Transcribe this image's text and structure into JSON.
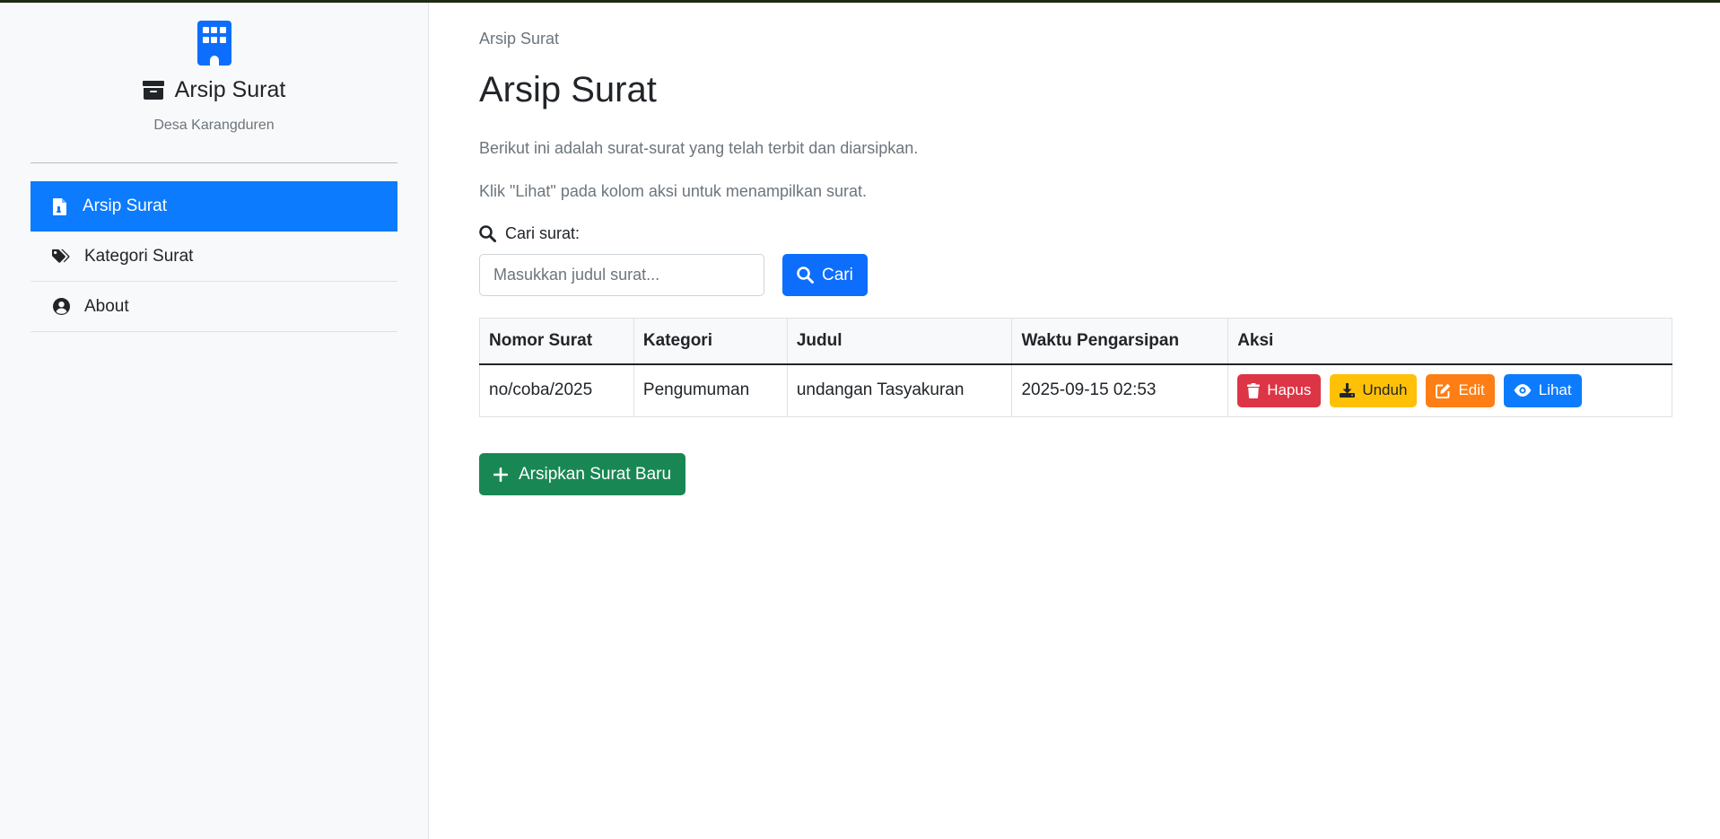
{
  "sidebar": {
    "title": "Arsip Surat",
    "subtitle": "Desa Karangduren",
    "items": [
      {
        "label": "Arsip Surat",
        "icon": "file-icon",
        "active": true
      },
      {
        "label": "Kategori Surat",
        "icon": "tags-icon",
        "active": false
      },
      {
        "label": "About",
        "icon": "user-circle-icon",
        "active": false
      }
    ]
  },
  "main": {
    "breadcrumb": "Arsip Surat",
    "title": "Arsip Surat",
    "description1": "Berikut ini adalah surat-surat yang telah terbit dan diarsipkan.",
    "description2": "Klik \"Lihat\" pada kolom aksi untuk menampilkan surat.",
    "search": {
      "label": "Cari surat:",
      "placeholder": "Masukkan judul surat...",
      "button": "Cari"
    },
    "table": {
      "headers": [
        "Nomor Surat",
        "Kategori",
        "Judul",
        "Waktu Pengarsipan",
        "Aksi"
      ],
      "rows": [
        {
          "nomor": "no/coba/2025",
          "kategori": "Pengumuman",
          "judul": "undangan Tasyakuran",
          "waktu": "2025-09-15 02:53",
          "actions": [
            "Hapus",
            "Unduh",
            "Edit",
            "Lihat"
          ]
        }
      ]
    },
    "new_button": "Arsipkan Surat Baru"
  },
  "colors": {
    "primary": "#0d6efd",
    "danger": "#dc3545",
    "warning": "#ffc107",
    "orange": "#fd7e14",
    "success": "#198754"
  }
}
